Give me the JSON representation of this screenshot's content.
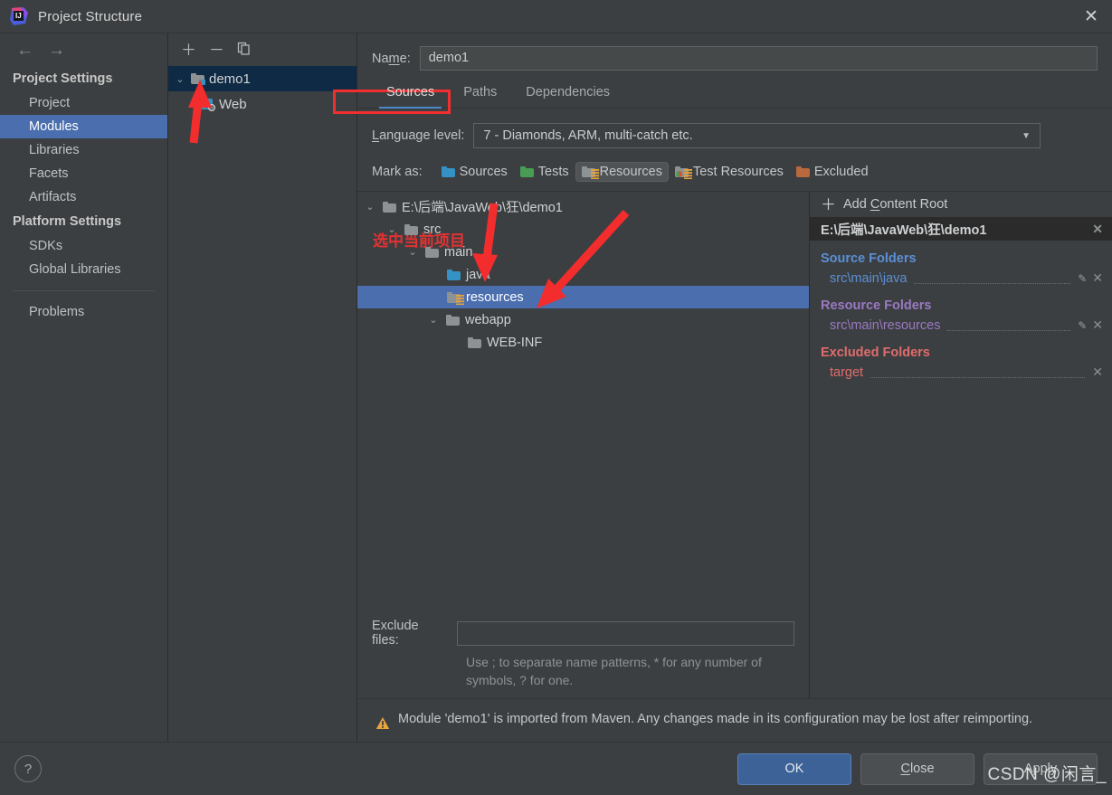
{
  "window": {
    "title": "Project Structure",
    "logo_icon": "intellij-idea-logo",
    "close_icon": "close-icon"
  },
  "sidebar": {
    "back_icon": "arrow-left-icon",
    "forward_icon": "arrow-right-icon",
    "groups": [
      {
        "label": "Project Settings",
        "items": [
          {
            "label": "Project",
            "selected": false
          },
          {
            "label": "Modules",
            "selected": true
          },
          {
            "label": "Libraries",
            "selected": false
          },
          {
            "label": "Facets",
            "selected": false
          },
          {
            "label": "Artifacts",
            "selected": false
          }
        ]
      },
      {
        "label": "Platform Settings",
        "items": [
          {
            "label": "SDKs",
            "selected": false
          },
          {
            "label": "Global Libraries",
            "selected": false
          }
        ]
      }
    ],
    "problems": "Problems"
  },
  "modules_panel": {
    "toolbar": {
      "add_icon": "plus-icon",
      "remove_icon": "minus-icon",
      "copy_icon": "copy-icon"
    },
    "tree": [
      {
        "label": "demo1",
        "icon": "module-folder-icon",
        "selected": true,
        "expanded": true
      },
      {
        "label": "Web",
        "icon": "web-facet-icon",
        "selected": false,
        "child": true
      }
    ],
    "annotation_note": "选中当前项目"
  },
  "module_editor": {
    "name_label": "Name:",
    "name_value": "demo1",
    "tabs": [
      {
        "label": "Sources",
        "active": true
      },
      {
        "label": "Paths",
        "active": false
      },
      {
        "label": "Dependencies",
        "active": false
      }
    ],
    "language_level_label": "Language level:",
    "language_level_value": "7 - Diamonds, ARM, multi-catch etc.",
    "mark_as_label": "Mark as:",
    "mark_as_buttons": [
      {
        "label": "Sources",
        "icon": "folder-blue-icon",
        "pressed": false
      },
      {
        "label": "Tests",
        "icon": "folder-green-icon",
        "pressed": false
      },
      {
        "label": "Resources",
        "icon": "folder-resources-icon",
        "pressed": true
      },
      {
        "label": "Test Resources",
        "icon": "folder-test-resources-icon",
        "pressed": false
      },
      {
        "label": "Excluded",
        "icon": "folder-orange-icon",
        "pressed": false
      }
    ],
    "file_tree": [
      {
        "label": "E:\\后端\\JavaWeb\\狂\\demo1",
        "indent": 0,
        "chevron": "down",
        "icon": "folder-gray-icon",
        "selected": false
      },
      {
        "label": "src",
        "indent": 1,
        "chevron": "down",
        "icon": "folder-gray-icon",
        "selected": false
      },
      {
        "label": "main",
        "indent": 2,
        "chevron": "down",
        "icon": "folder-gray-icon",
        "selected": false
      },
      {
        "label": "java",
        "indent": 3,
        "chevron": "none",
        "icon": "folder-blue-icon",
        "selected": false
      },
      {
        "label": "resources",
        "indent": 3,
        "chevron": "none",
        "icon": "folder-resources-icon",
        "selected": true
      },
      {
        "label": "webapp",
        "indent": 2,
        "chevron": "down",
        "icon": "folder-gray-icon",
        "selected": false
      },
      {
        "label": "WEB-INF",
        "indent": 3,
        "chevron": "none",
        "icon": "folder-gray-icon",
        "selected": false
      }
    ],
    "exclude_files_label": "Exclude files:",
    "exclude_files_value": "",
    "exclude_hint": "Use ; to separate name patterns, * for any number of symbols, ? for one.",
    "warning_icon": "warning-triangle-icon",
    "warning_text": "Module 'demo1' is imported from Maven. Any changes made in its configuration may be lost after reimporting."
  },
  "content_roots": {
    "add_label": "Add Content Root",
    "add_icon": "plus-icon",
    "root_path": "E:\\后端\\JavaWeb\\狂\\demo1",
    "root_remove_icon": "close-icon",
    "sections": [
      {
        "title": "Source Folders",
        "kind": "src",
        "items": [
          {
            "label": "src\\main\\java",
            "edit_icon": "pencil-icon",
            "remove_icon": "close-icon",
            "has_edit": true
          }
        ]
      },
      {
        "title": "Resource Folders",
        "kind": "res",
        "items": [
          {
            "label": "src\\main\\resources",
            "edit_icon": "pencil-icon",
            "remove_icon": "close-icon",
            "has_edit": true
          }
        ]
      },
      {
        "title": "Excluded Folders",
        "kind": "exc",
        "items": [
          {
            "label": "target",
            "remove_icon": "close-icon",
            "has_edit": false
          }
        ]
      }
    ]
  },
  "footer": {
    "help_label": "?",
    "help_icon": "help-icon",
    "buttons": [
      {
        "label": "OK",
        "style": "primary"
      },
      {
        "label": "Close",
        "style": "normal"
      },
      {
        "label": "Apply",
        "style": "normal"
      }
    ]
  },
  "watermark": "CSDN @闲言_",
  "colors": {
    "background": "#3c3f41",
    "selection_blue": "#4b6eaf",
    "module_selection": "#0f2a45",
    "accent_tab": "#4a88c7",
    "annotation_red": "#f12f2f",
    "source_folder": "#5b8fd6",
    "resource_folder": "#9a79c2",
    "excluded_folder": "#e06c6c",
    "warning_amber": "#e8a33d"
  }
}
